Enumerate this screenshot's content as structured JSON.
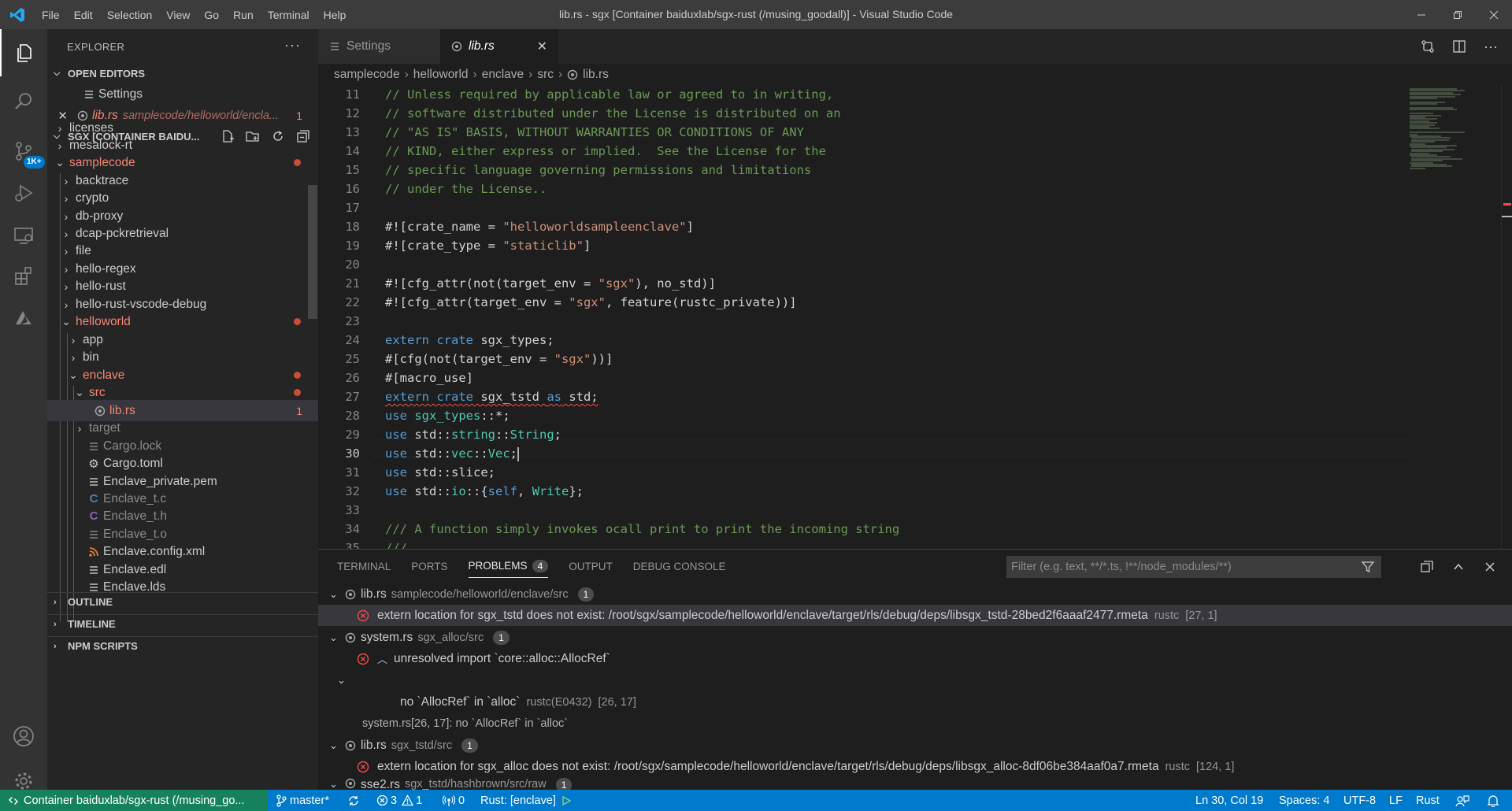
{
  "titlebar": {
    "title": "lib.rs - sgx [Container baiduxlab/sgx-rust (/musing_goodall)] - Visual Studio Code",
    "menu": [
      "File",
      "Edit",
      "Selection",
      "View",
      "Go",
      "Run",
      "Terminal",
      "Help"
    ]
  },
  "activity": {
    "scm_badge": "1K+"
  },
  "explorer": {
    "title": "EXPLORER",
    "open_editors_label": "OPEN EDITORS",
    "open_editors": [
      {
        "name": "Settings"
      },
      {
        "name": "lib.rs",
        "path": "samplecode/helloworld/encla...",
        "count": "1"
      }
    ],
    "workspace_label": "SGX [CONTAINER BAIDU...",
    "tree": [
      {
        "name": "licenses"
      },
      {
        "name": "mesalock-rt"
      },
      {
        "name": "samplecode"
      },
      {
        "name": "backtrace"
      },
      {
        "name": "crypto"
      },
      {
        "name": "db-proxy"
      },
      {
        "name": "dcap-pckretrieval"
      },
      {
        "name": "file"
      },
      {
        "name": "hello-regex"
      },
      {
        "name": "hello-rust"
      },
      {
        "name": "hello-rust-vscode-debug"
      },
      {
        "name": "helloworld"
      },
      {
        "name": "app"
      },
      {
        "name": "bin"
      },
      {
        "name": "enclave"
      },
      {
        "name": "src"
      },
      {
        "name": "lib.rs",
        "count": "1"
      },
      {
        "name": "target"
      },
      {
        "name": "Cargo.lock"
      },
      {
        "name": "Cargo.toml"
      },
      {
        "name": "Enclave_private.pem"
      },
      {
        "name": "Enclave_t.c"
      },
      {
        "name": "Enclave_t.h"
      },
      {
        "name": "Enclave_t.o"
      },
      {
        "name": "Enclave.config.xml"
      },
      {
        "name": "Enclave.edl"
      },
      {
        "name": "Enclave.lds"
      }
    ],
    "outline_label": "OUTLINE",
    "timeline_label": "TIMELINE",
    "npm_label": "NPM SCRIPTS"
  },
  "tabs": [
    {
      "label": "Settings"
    },
    {
      "label": "lib.rs"
    }
  ],
  "breadcrumb": [
    "samplecode",
    "helloworld",
    "enclave",
    "src",
    "lib.rs"
  ],
  "editor": {
    "line_numbers": [
      "11",
      "12",
      "13",
      "14",
      "15",
      "16",
      "17",
      "18",
      "19",
      "20",
      "21",
      "22",
      "23",
      "24",
      "25",
      "26",
      "27",
      "28",
      "29",
      "30",
      "31",
      "32",
      "33",
      "34",
      "35"
    ],
    "current_line": "30"
  },
  "panel": {
    "tabs": [
      "TERMINAL",
      "PORTS",
      "PROBLEMS",
      "OUTPUT",
      "DEBUG CONSOLE"
    ],
    "problems_count": "4",
    "filter_placeholder": "Filter (e.g. text, **/*.ts, !**/node_modules/**)",
    "problems": [
      {
        "file": "lib.rs",
        "dir": "samplecode/helloworld/enclave/src",
        "count": "1",
        "message": "extern location for sgx_tstd does not exist: /root/sgx/samplecode/helloworld/enclave/target/rls/debug/deps/libsgx_tstd-28bed2f6aaaf2477.rmeta",
        "source": "rustc",
        "pos": "[27, 1]"
      },
      {
        "file": "system.rs",
        "dir": "sgx_alloc/src",
        "count": "1",
        "message": "unresolved import `core::alloc::AllocRef`",
        "detail": "no `AllocRef` in `alloc`",
        "detail_source": "rustc(E0432)",
        "detail_pos": "[26, 17]",
        "related": "system.rs[26, 17]: no `AllocRef` in `alloc`"
      },
      {
        "file": "lib.rs",
        "dir": "sgx_tstd/src",
        "count": "1",
        "message": "extern location for sgx_alloc does not exist: /root/sgx/samplecode/helloworld/enclave/target/rls/debug/deps/libsgx_alloc-8df06be384aaf0a7.rmeta",
        "source": "rustc",
        "pos": "[124, 1]"
      },
      {
        "file": "sse2.rs",
        "dir": "sgx_tstd/hashbrown/src/raw",
        "count": "1"
      }
    ]
  },
  "statusbar": {
    "remote": "Container baiduxlab/sgx-rust (/musing_go...",
    "branch": "master*",
    "errors": "3",
    "warnings": "1",
    "ports": "0",
    "rust": "Rust: [enclave]",
    "position": "Ln 30, Col 19",
    "spaces": "Spaces: 4",
    "encoding": "UTF-8",
    "eol": "LF",
    "language": "Rust"
  }
}
